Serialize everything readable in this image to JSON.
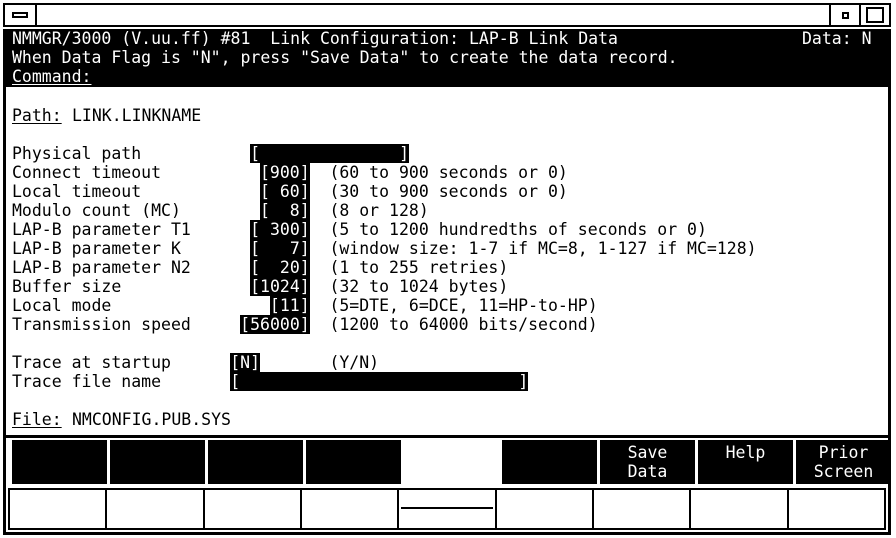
{
  "window": {
    "minimize_glyph": "minimize-icon",
    "restore_glyph": "restore-icon",
    "maximize_glyph": "maximize-icon",
    "caption": ""
  },
  "banner": {
    "line1_left": "NMMGR/3000 (V.uu.ff) #81  Link Configuration: LAP-B Link Data",
    "line1_right": "Data: N",
    "line2": "When Data Flag is \"N\", press \"Save Data\" to create the data record.",
    "command_label": "Command:",
    "command_value": ""
  },
  "path": {
    "label": "Path:",
    "value": "LINK.LINKNAME"
  },
  "file": {
    "label": "File:",
    "value": "NMCONFIG.PUB.SYS"
  },
  "fields": [
    {
      "label": "Physical path",
      "value": "",
      "field_text": "[              ]",
      "hint": ""
    },
    {
      "label": "Connect timeout",
      "value": "900",
      "field_text": "[900]",
      "hint": "(60 to 900 seconds or 0)"
    },
    {
      "label": "Local timeout",
      "value": "60",
      "field_text": "[ 60]",
      "hint": "(30 to 900 seconds or 0)"
    },
    {
      "label": "Modulo count (MC)",
      "value": "8",
      "field_text": "[  8]",
      "hint": "(8 or 128)"
    },
    {
      "label": "LAP-B parameter T1",
      "value": "300",
      "field_text": "[ 300]",
      "hint": "(5 to 1200 hundredths of seconds or 0)"
    },
    {
      "label": "LAP-B parameter K",
      "value": "7",
      "field_text": "[   7]",
      "hint": "(window size: 1-7 if MC=8, 1-127 if MC=128)"
    },
    {
      "label": "LAP-B parameter N2",
      "value": "20",
      "field_text": "[  20]",
      "hint": "(1 to 255 retries)"
    },
    {
      "label": "Buffer size",
      "value": "1024",
      "field_text": "[1024]",
      "hint": "(32 to 1024 bytes)"
    },
    {
      "label": "Local mode",
      "value": "11",
      "field_text": "[11]",
      "hint": "(5=DTE, 6=DCE, 11=HP-to-HP)"
    },
    {
      "label": "Transmission speed",
      "value": "56000",
      "field_text": "[56000]",
      "hint": "(1200 to 64000 bits/second)"
    }
  ],
  "trace": [
    {
      "label": "Trace at startup",
      "value": "N",
      "field_text": "[N]",
      "hint": "(Y/N)"
    },
    {
      "label": "Trace file name",
      "value": "",
      "field_text": "[                            ]",
      "hint": ""
    }
  ],
  "function_keys": [
    {
      "label": "",
      "blank": false
    },
    {
      "label": "",
      "blank": false
    },
    {
      "label": "",
      "blank": false
    },
    {
      "label": "",
      "blank": false
    },
    {
      "label": "",
      "blank": true
    },
    {
      "label": "",
      "blank": false
    },
    {
      "label": "Save\nData",
      "blank": false
    },
    {
      "label": "Help",
      "blank": false
    },
    {
      "label": "Prior\nScreen",
      "blank": false
    }
  ],
  "colors": {
    "foreground": "#000000",
    "background": "#ffffff",
    "inverse_fg": "#ffffff",
    "inverse_bg": "#000000"
  }
}
